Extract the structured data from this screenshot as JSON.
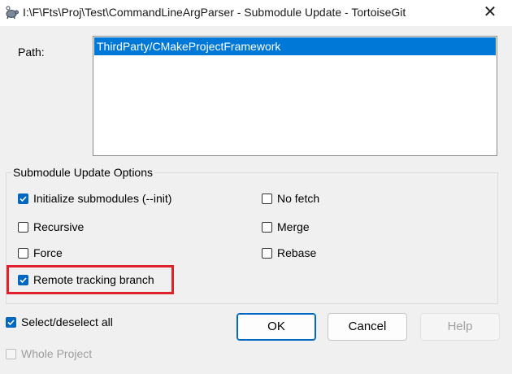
{
  "window": {
    "title": "I:\\F\\Fts\\Proj\\Test\\CommandLineArgParser - Submodule Update - TortoiseGit",
    "app_icon": "tortoisegit-icon",
    "close_glyph": "✕"
  },
  "path": {
    "label": "Path:",
    "items": [
      "ThirdParty/CMakeProjectFramework"
    ]
  },
  "options": {
    "group_title": "Submodule Update Options",
    "init": {
      "label": "Initialize submodules (--init)",
      "checked": true
    },
    "no_fetch": {
      "label": "No fetch",
      "checked": false
    },
    "recursive": {
      "label": "Recursive",
      "checked": false
    },
    "merge": {
      "label": "Merge",
      "checked": false
    },
    "force": {
      "label": "Force",
      "checked": false
    },
    "rebase": {
      "label": "Rebase",
      "checked": false
    },
    "remote": {
      "label": "Remote tracking branch",
      "checked": true
    }
  },
  "footer": {
    "select_all": {
      "label": "Select/deselect all",
      "checked": true
    },
    "whole_project": {
      "label": "Whole Project",
      "checked": false,
      "disabled": true
    }
  },
  "buttons": {
    "ok": "OK",
    "cancel": "Cancel",
    "help": "Help"
  },
  "colors": {
    "accent": "#0067c0",
    "selection": "#0078d7",
    "highlight_border": "#e0202a"
  }
}
